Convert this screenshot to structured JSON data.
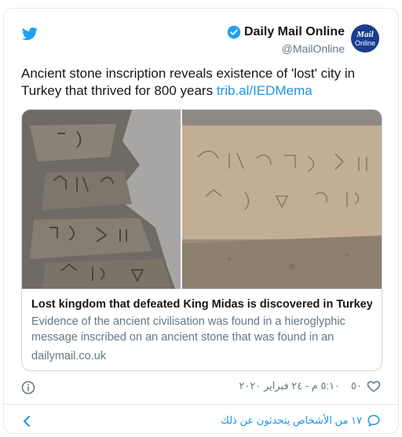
{
  "author": {
    "name": "Daily Mail Online",
    "handle": "@MailOnline",
    "avatar_line1": "Mail",
    "avatar_line2": "Online"
  },
  "tweet": {
    "text": "Ancient stone inscription reveals existence of 'lost' city in Turkey that thrived for 800 years ",
    "link": "trib.al/IEDMema"
  },
  "card": {
    "title": "Lost kingdom that defeated King Midas is discovered in Turkey",
    "description": "Evidence of the ancient civilisation was found in a hieroglyphic message inscribed on an ancient stone that was found in an",
    "domain": "dailymail.co.uk"
  },
  "meta": {
    "timestamp": "٥:١٠ م - ٢٤ فبراير ٢٠٢٠",
    "likes": "٥٠"
  },
  "footer": {
    "replies_text": "١٧ من الأشخاص يتحدثون عن ذلك"
  },
  "colors": {
    "twitter_blue": "#1da1f2",
    "link_blue": "#1b95e0",
    "muted": "#657786",
    "avatar_bg": "#1a3d8f"
  },
  "icons": [
    "twitter-bird-icon",
    "verified-badge-icon",
    "info-icon",
    "heart-icon",
    "back-chevron-icon",
    "reply-icon"
  ]
}
